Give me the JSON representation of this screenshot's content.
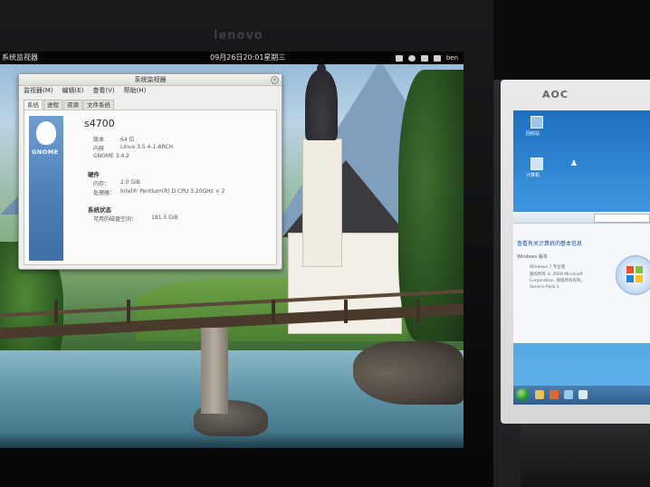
{
  "left_monitor": {
    "brand": "lenovo",
    "topbar": {
      "activities": "系统监视器",
      "clock": "09月26日20:01星期三",
      "user": "ben"
    },
    "system_monitor": {
      "title": "系统监视器",
      "menu": [
        "监视器(M)",
        "编辑(E)",
        "查看(V)",
        "帮助(H)"
      ],
      "tabs": [
        "系统",
        "进程",
        "资源",
        "文件系统"
      ],
      "active_tab": "系统",
      "logo_text": "GNOME",
      "hostname": "s4700",
      "version_label": "版本",
      "version_value": "64 位",
      "kernel_label": "内核",
      "kernel_value": "Linux 3.5.4-1-ARCH",
      "gnome_version": "GNOME 3.4.2",
      "hardware_heading": "硬件",
      "memory_label": "内存：",
      "memory_value": "2.0 GiB",
      "cpu_label": "处理器：",
      "cpu_value": "Intel® Pentium(R) D CPU 3.20GHz × 2",
      "status_heading": "系统状态",
      "disk_label": "可用的磁盘空间：",
      "disk_value": "181.5 GiB"
    }
  },
  "right_monitor": {
    "brand": "AOC",
    "desktop_icons": [
      "回收站",
      "计算机"
    ],
    "window": {
      "heading": "查看有关计算机的基本信息",
      "edition_label": "Windows 版本",
      "lines": [
        "Windows 7 专业版",
        "版权所有 © 2009 Microsoft",
        "Corporation. 保留所有权利。",
        "Service Pack 1"
      ]
    }
  },
  "colors": {
    "gnome_blue": "#4d7fb8",
    "win7_blue": "#1e6fc0",
    "topbar": "#050505"
  }
}
